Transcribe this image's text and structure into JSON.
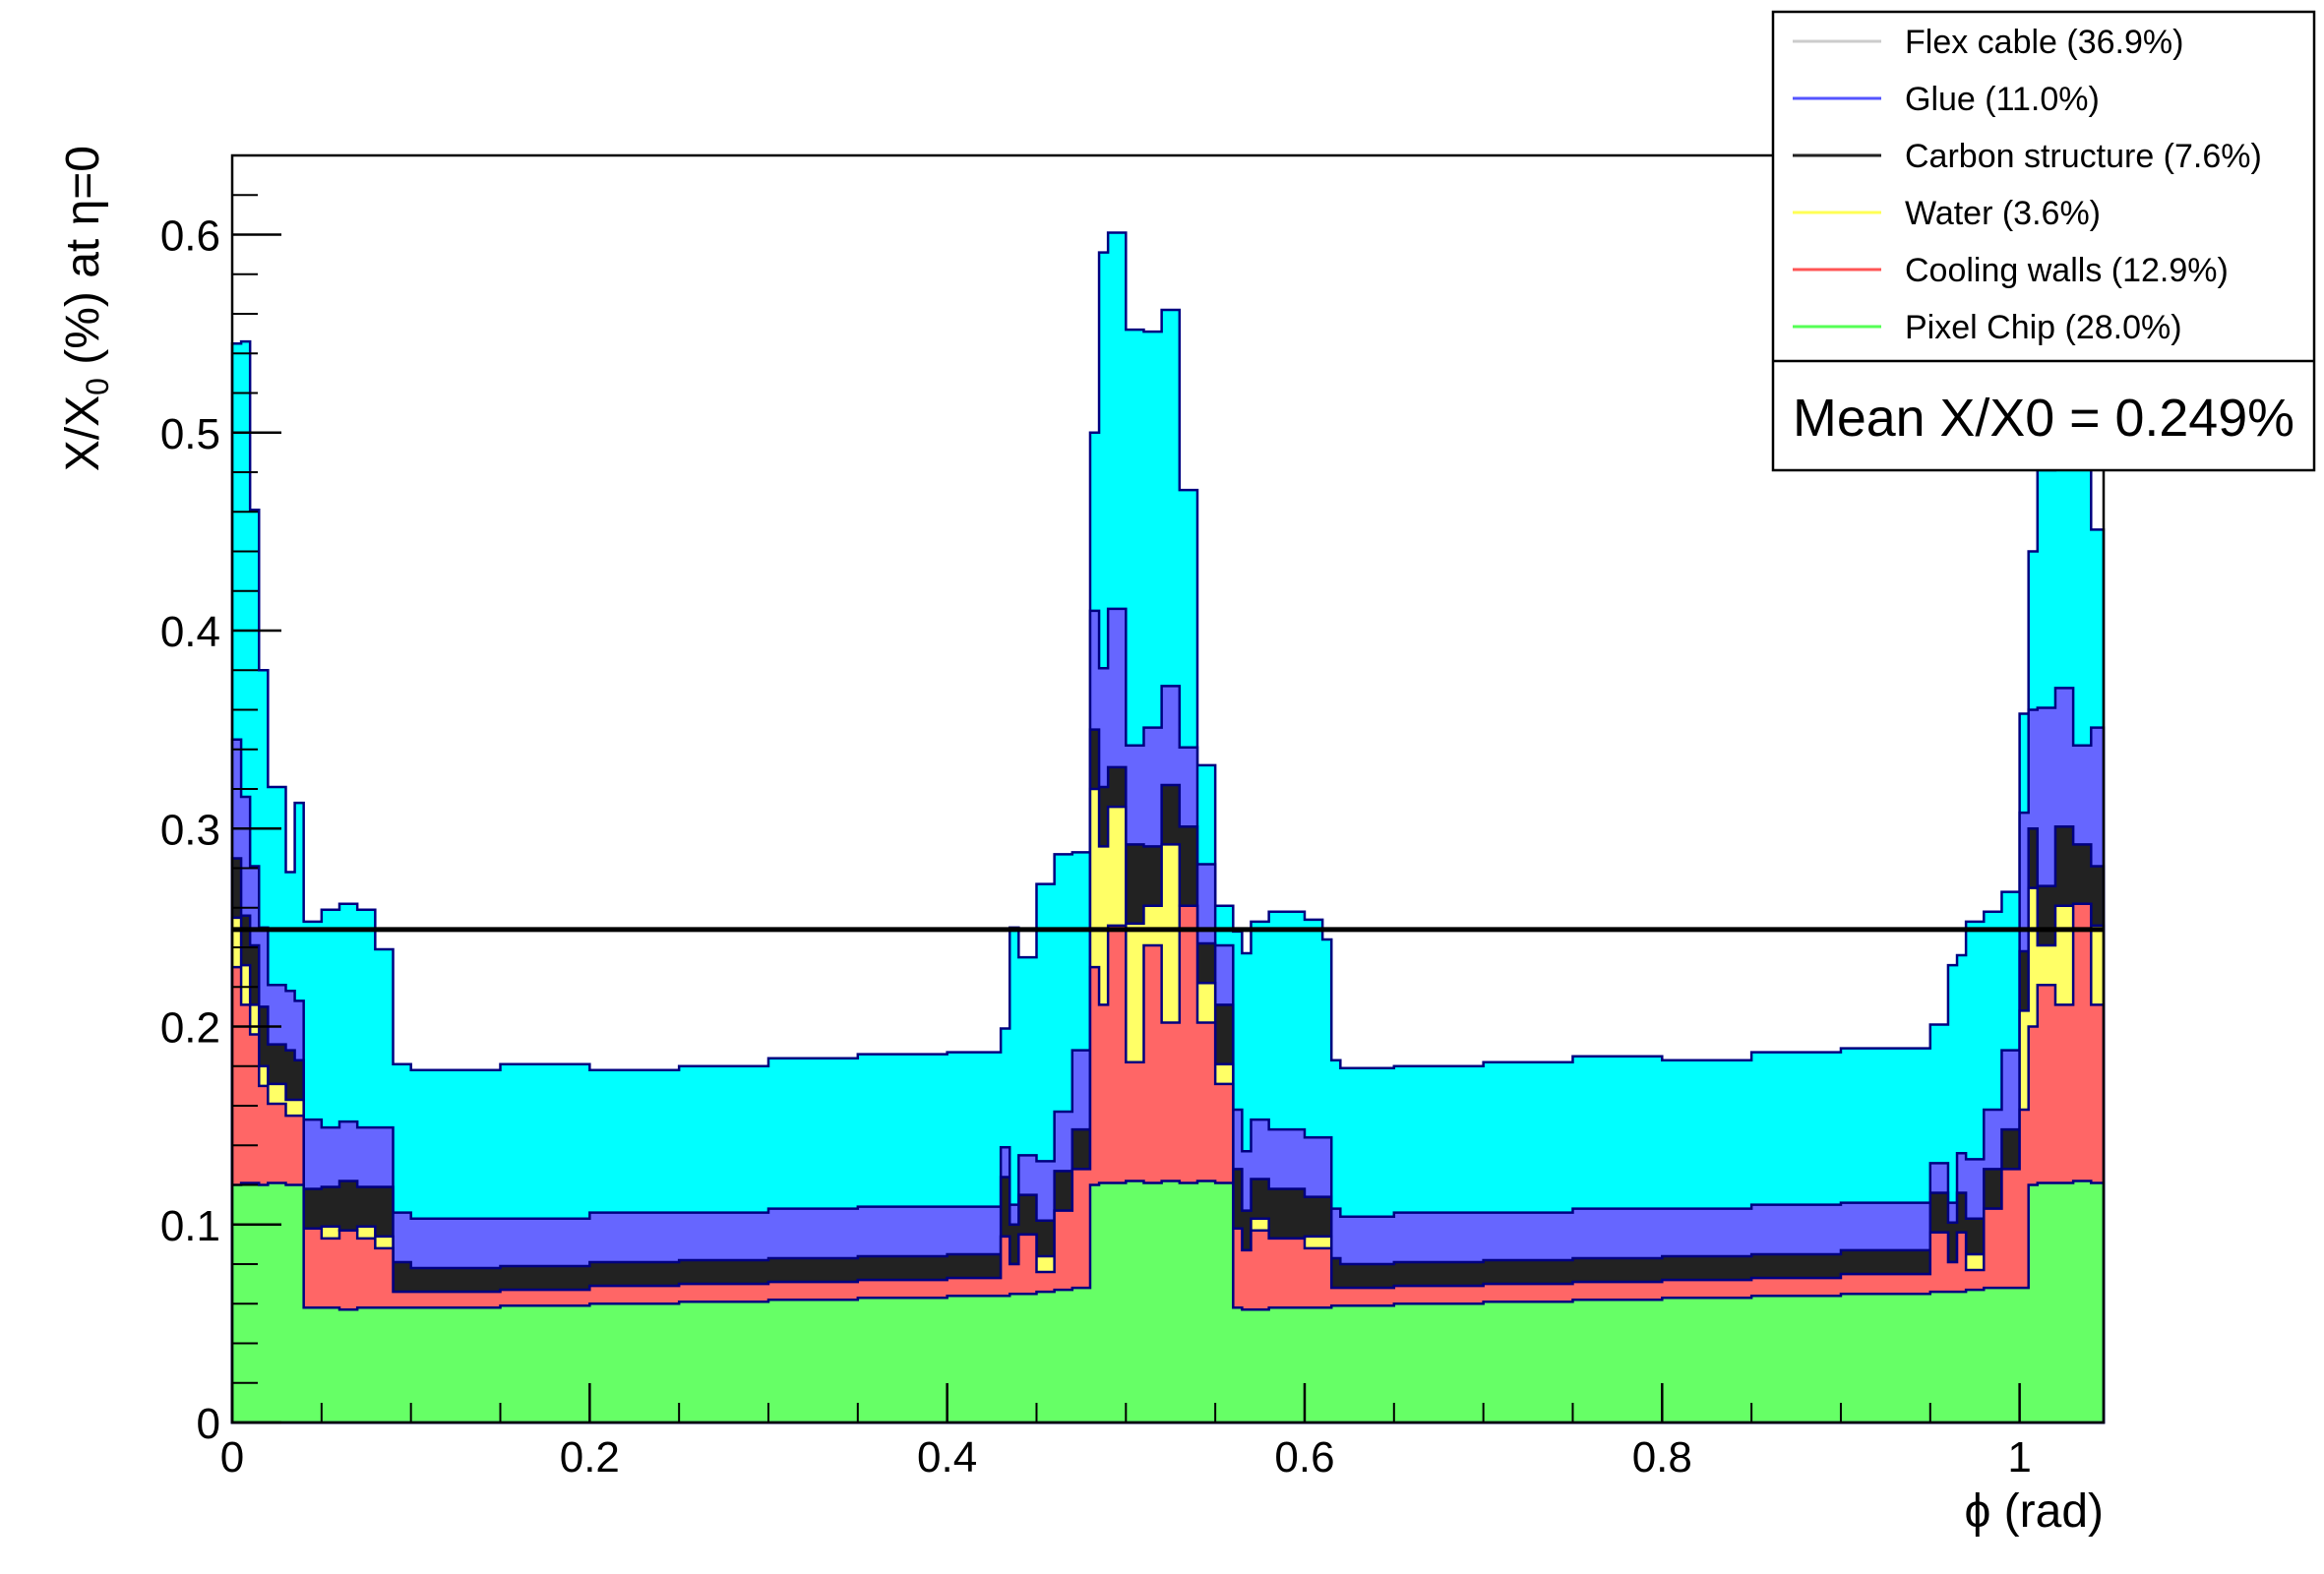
{
  "chart_data": {
    "type": "area",
    "stacked": true,
    "xlabel": "ϕ (rad)",
    "ylabel_main": "X/X",
    "ylabel_sub": "0",
    "ylabel_tail": " (%) at η=0",
    "xlim": [
      0,
      1.047
    ],
    "ylim": [
      0,
      0.64
    ],
    "x_ticks": [
      0,
      0.2,
      0.4,
      0.6,
      0.8,
      1
    ],
    "x_tick_labels": [
      "0",
      "0.2",
      "0.4",
      "0.6",
      "0.8",
      "1"
    ],
    "y_ticks": [
      0,
      0.1,
      0.2,
      0.3,
      0.4,
      0.5,
      0.6
    ],
    "y_tick_labels": [
      "0",
      "0.1",
      "0.2",
      "0.3",
      "0.4",
      "0.5",
      "0.6"
    ],
    "mean_line": 0.249,
    "mean_label": "Mean X/X0 =  0.249%",
    "x": [
      0,
      0.005,
      0.01,
      0.015,
      0.02,
      0.03,
      0.035,
      0.04,
      0.05,
      0.06,
      0.07,
      0.08,
      0.09,
      0.1,
      0.15,
      0.2,
      0.25,
      0.3,
      0.35,
      0.4,
      0.43,
      0.435,
      0.44,
      0.45,
      0.46,
      0.47,
      0.48,
      0.485,
      0.49,
      0.5,
      0.51,
      0.52,
      0.53,
      0.54,
      0.55,
      0.56,
      0.565,
      0.57,
      0.58,
      0.6,
      0.61,
      0.615,
      0.62,
      0.65,
      0.7,
      0.75,
      0.8,
      0.85,
      0.9,
      0.95,
      0.96,
      0.965,
      0.97,
      0.98,
      0.99,
      1.0,
      1.005,
      1.01,
      1.02,
      1.03,
      1.04,
      1.047
    ],
    "series": [
      {
        "name": "Pixel Chip (28.0%)",
        "color": "#66ff66",
        "values": [
          0.12,
          0.121,
          0.121,
          0.12,
          0.121,
          0.12,
          0.12,
          0.058,
          0.058,
          0.057,
          0.058,
          0.058,
          0.058,
          0.058,
          0.059,
          0.06,
          0.061,
          0.062,
          0.063,
          0.064,
          0.064,
          0.065,
          0.065,
          0.066,
          0.067,
          0.068,
          0.12,
          0.121,
          0.121,
          0.122,
          0.121,
          0.122,
          0.121,
          0.122,
          0.121,
          0.058,
          0.057,
          0.057,
          0.058,
          0.058,
          0.058,
          0.059,
          0.059,
          0.06,
          0.061,
          0.062,
          0.063,
          0.064,
          0.065,
          0.066,
          0.066,
          0.066,
          0.067,
          0.068,
          0.068,
          0.068,
          0.12,
          0.121,
          0.121,
          0.122,
          0.121,
          0.12
        ]
      },
      {
        "name": "Cooling walls (12.9%)",
        "color": "#ff6666",
        "values": [
          0.11,
          0.09,
          0.075,
          0.05,
          0.04,
          0.035,
          0.035,
          0.04,
          0.035,
          0.04,
          0.035,
          0.03,
          0.008,
          0.008,
          0.008,
          0.009,
          0.009,
          0.009,
          0.009,
          0.009,
          0.03,
          0.015,
          0.03,
          0.01,
          0.04,
          0.06,
          0.11,
          0.09,
          0.13,
          0.06,
          0.12,
          0.08,
          0.14,
          0.08,
          0.05,
          0.04,
          0.03,
          0.04,
          0.035,
          0.03,
          0.03,
          0.009,
          0.009,
          0.009,
          0.009,
          0.009,
          0.009,
          0.009,
          0.01,
          0.03,
          0.015,
          0.03,
          0.01,
          0.04,
          0.06,
          0.09,
          0.08,
          0.1,
          0.09,
          0.14,
          0.09,
          0.09
        ]
      },
      {
        "name": "Water (3.6%)",
        "color": "#ffff66",
        "values": [
          0.025,
          0.02,
          0.015,
          0.01,
          0.01,
          0.008,
          0.008,
          0.0,
          0.006,
          0.0,
          0.006,
          0.006,
          0.0,
          0.0,
          0.0,
          0.0,
          0.0,
          0.0,
          0.0,
          0.0,
          0.0,
          0.0,
          0.0,
          0.008,
          0.0,
          0.0,
          0.09,
          0.08,
          0.06,
          0.07,
          0.02,
          0.09,
          0.0,
          0.02,
          0.01,
          0.0,
          0.0,
          0.006,
          0.0,
          0.006,
          0.006,
          0.0,
          0.0,
          0.0,
          0.0,
          0.0,
          0.0,
          0.0,
          0.0,
          0.0,
          0.0,
          0.0,
          0.008,
          0.0,
          0.0,
          0.05,
          0.07,
          0.02,
          0.05,
          0.0,
          0.04,
          0.03
        ]
      },
      {
        "name": "Carbon structure (7.6%)",
        "color": "#222222",
        "values": [
          0.03,
          0.025,
          0.03,
          0.03,
          0.02,
          0.025,
          0.02,
          0.02,
          0.02,
          0.025,
          0.02,
          0.025,
          0.015,
          0.012,
          0.012,
          0.012,
          0.012,
          0.012,
          0.012,
          0.012,
          0.03,
          0.02,
          0.02,
          0.018,
          0.02,
          0.02,
          0.03,
          0.03,
          0.02,
          0.04,
          0.03,
          0.03,
          0.04,
          0.02,
          0.03,
          0.03,
          0.02,
          0.02,
          0.025,
          0.02,
          0.02,
          0.015,
          0.012,
          0.012,
          0.012,
          0.012,
          0.012,
          0.012,
          0.012,
          0.02,
          0.02,
          0.02,
          0.018,
          0.02,
          0.02,
          0.03,
          0.03,
          0.03,
          0.04,
          0.03,
          0.03,
          0.02
        ]
      },
      {
        "name": "Glue (11.0%)",
        "color": "#6666ff",
        "values": [
          0.06,
          0.06,
          0.04,
          0.04,
          0.03,
          0.03,
          0.03,
          0.035,
          0.03,
          0.03,
          0.03,
          0.03,
          0.025,
          0.025,
          0.024,
          0.025,
          0.024,
          0.025,
          0.025,
          0.024,
          0.015,
          0.01,
          0.02,
          0.03,
          0.03,
          0.04,
          0.06,
          0.06,
          0.08,
          0.05,
          0.06,
          0.05,
          0.04,
          0.04,
          0.03,
          0.03,
          0.03,
          0.03,
          0.03,
          0.03,
          0.03,
          0.025,
          0.024,
          0.025,
          0.024,
          0.025,
          0.024,
          0.025,
          0.024,
          0.015,
          0.01,
          0.02,
          0.03,
          0.03,
          0.04,
          0.07,
          0.06,
          0.09,
          0.07,
          0.05,
          0.07,
          0.08
        ]
      },
      {
        "name": "Flex cable (36.9%)",
        "color": "#00ffff",
        "values": [
          0.2,
          0.23,
          0.18,
          0.13,
          0.1,
          0.06,
          0.1,
          0.1,
          0.11,
          0.11,
          0.11,
          0.09,
          0.075,
          0.075,
          0.078,
          0.072,
          0.074,
          0.076,
          0.077,
          0.078,
          0.06,
          0.14,
          0.1,
          0.14,
          0.13,
          0.1,
          0.09,
          0.21,
          0.19,
          0.21,
          0.2,
          0.19,
          0.13,
          0.05,
          0.02,
          0.09,
          0.1,
          0.1,
          0.11,
          0.11,
          0.1,
          0.075,
          0.075,
          0.074,
          0.076,
          0.077,
          0.075,
          0.077,
          0.078,
          0.07,
          0.12,
          0.1,
          0.12,
          0.1,
          0.08,
          0.05,
          0.08,
          0.12,
          0.2,
          0.2,
          0.1,
          0.1
        ]
      }
    ],
    "legend": {
      "position": "top-right",
      "entries": [
        {
          "label": "Flex cable (36.9%)",
          "color": "#cccccc"
        },
        {
          "label": "Glue (11.0%)",
          "color": "#5555ff"
        },
        {
          "label": "Carbon structure (7.6%)",
          "color": "#222222"
        },
        {
          "label": "Water (3.6%)",
          "color": "#ffff55"
        },
        {
          "label": "Cooling walls (12.9%)",
          "color": "#ff5555"
        },
        {
          "label": "Pixel Chip (28.0%)",
          "color": "#55ff55"
        }
      ]
    }
  }
}
